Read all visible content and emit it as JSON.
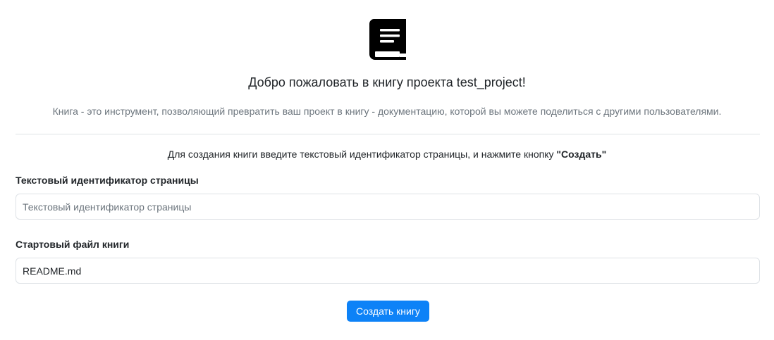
{
  "header": {
    "icon": "book-icon",
    "title": "Добро пожаловать в книгу проекта test_project!",
    "description": "Книга - это инструмент, позволяющий превратить ваш проект в книгу - документацию, которой вы можете поделиться с другими пользователями."
  },
  "instruction": {
    "text": "Для создания книги введите текстовый идентификатор страницы, и нажмите кнопку ",
    "button_ref": "\"Создать\""
  },
  "form": {
    "page_id": {
      "label": "Текстовый идентификатор страницы",
      "placeholder": "Текстовый идентификатор страницы",
      "value": ""
    },
    "start_file": {
      "label": "Стартовый файл книги",
      "placeholder": "",
      "value": "README.md"
    },
    "submit_label": "Создать книгу"
  },
  "colors": {
    "accent": "#0d82f7",
    "muted_text": "#6c757d",
    "border": "#dee2e6"
  }
}
